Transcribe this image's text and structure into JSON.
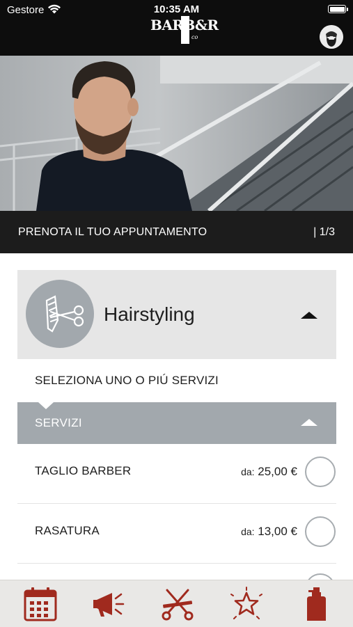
{
  "status_bar": {
    "carrier": "Gestore",
    "time": "10:35 AM"
  },
  "header": {
    "logo_text": "BARB&R",
    "logo_name": "barber-logo",
    "avatar_icon": "bearded-man-avatar-icon"
  },
  "booking": {
    "title": "PRENOTA IL TUO APPUNTAMENTO",
    "step": "| 1/3"
  },
  "category": {
    "name": "Hairstyling",
    "icon": "scissors-comb-icon",
    "expanded": true
  },
  "instruction": "SELEZIONA UNO O PIÚ SERVIZI",
  "services_section": {
    "label": "SERVIZI",
    "expanded": true
  },
  "services": [
    {
      "name": "TAGLIO BARBER",
      "price_prefix": "da:",
      "price": "25,00 €",
      "selected": false
    },
    {
      "name": "RASATURA",
      "price_prefix": "da:",
      "price": "13,00 €",
      "selected": false
    },
    {
      "name": "",
      "price_prefix": "",
      "price": "",
      "selected": false
    }
  ],
  "tab_bar": {
    "items": [
      {
        "icon": "calendar-icon"
      },
      {
        "icon": "megaphone-icon"
      },
      {
        "icon": "scissors-comb-icon"
      },
      {
        "icon": "star-icon"
      },
      {
        "icon": "product-bottle-icon"
      }
    ],
    "icon_color": "#a02a1e"
  },
  "colors": {
    "header_bg": "#0d0d0d",
    "booking_bar_bg": "#1c1c1c",
    "panel_bg": "#e6e6e6",
    "accent_grey": "#a2a8ad",
    "tab_icon": "#a02a1e"
  }
}
